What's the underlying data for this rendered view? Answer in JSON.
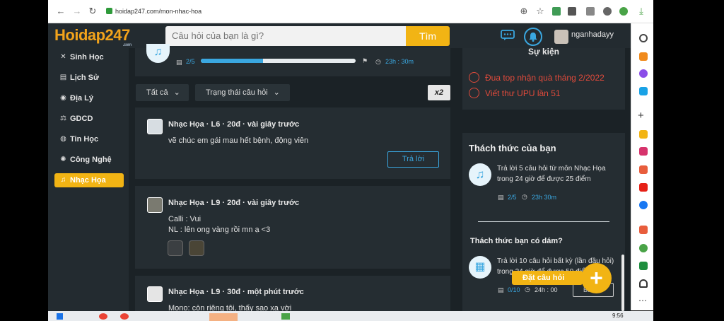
{
  "browser": {
    "url": "hoidap247.com/mon-nhac-hoa",
    "clock": "9:56"
  },
  "header": {
    "logo_text": "Hoidap247",
    "logo_sub": ".com",
    "search_placeholder": "Câu hỏi của bạn là gì?",
    "search_button": "Tìm",
    "username": "nganhadayy"
  },
  "sidebar": {
    "items": [
      {
        "label": "Sinh Học",
        "icon": "dna-icon"
      },
      {
        "label": "Lịch Sử",
        "icon": "scroll-icon"
      },
      {
        "label": "Địa Lý",
        "icon": "globe-icon"
      },
      {
        "label": "GDCD",
        "icon": "scales-icon"
      },
      {
        "label": "Tin Học",
        "icon": "computer-icon"
      },
      {
        "label": "Công Nghệ",
        "icon": "gear-icon"
      },
      {
        "label": "Nhạc Họa",
        "icon": "music-note-icon",
        "active": true
      }
    ]
  },
  "top_challenge": {
    "progress_text": "2/5",
    "progress": 0.4,
    "timer": "23h : 30m"
  },
  "filters": {
    "all_label": "Tất cả",
    "status_label": "Trạng thái câu hỏi",
    "x2_label": "x2"
  },
  "posts": [
    {
      "meta": "Nhạc Họa · L6 · 20đ · vài giây trước",
      "body": "vẽ chúc em gái  mau hết bệnh, động viên",
      "reply_label": "Trả lời"
    },
    {
      "meta": "Nhạc Họa · L9 · 20đ · vài giây trước",
      "body_line1": "Calli : Vui",
      "body_line2": "NL : lên ong vàng rồi mn ạ <3"
    },
    {
      "meta": "Nhạc Họa · L9 · 30đ · một phút trước",
      "body": "Mono: còn riêng tôi, thấy sao xa vời"
    }
  ],
  "events": {
    "title": "Sự kiện",
    "items": [
      "Đua top nhận quà tháng 2/2022",
      "Viết thư UPU lần 51"
    ]
  },
  "challenges": {
    "title": "Thách thức của bạn",
    "item1": {
      "text_line1": "Trả lời 5 câu hỏi  từ môn Nhạc Họa",
      "text_line2": "trong 24 giờ để được 25 điểm",
      "progress": "2/5",
      "time": "23h   30m"
    },
    "dare_title": "Thách thức bạn có dám?",
    "item2": {
      "text_line1": "Trả lời 10 câu hỏi  bất kỳ (lần đầu hỏi)",
      "text_line2": "trong 24 giờ để được 50 điểm",
      "progress": "0/10",
      "time": "24h : 00",
      "start_label": "Bắt"
    },
    "ask_button": "Đặt câu hỏi"
  },
  "colors": {
    "accent": "#f2b414",
    "blue": "#3aa7e0",
    "red": "#e04a3b",
    "dark_bg": "#1b2226"
  }
}
